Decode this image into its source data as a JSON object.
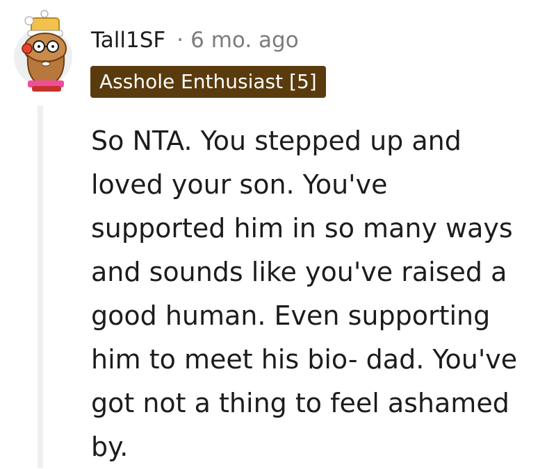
{
  "comment": {
    "author": "Tall1SF",
    "separator": "·",
    "timestamp": "6 mo. ago",
    "flair": "Asshole Enthusiast [5]",
    "avatar_icon": "snoo-avatar-icon",
    "body": "So NTA. You stepped up and\nloved your son. You've\nsupported him in so many ways\nand sounds like you've raised a\ngood human. Even supporting\nhim to meet his bio- dad. You've\ngot not a thing to feel ashamed\nby."
  },
  "colors": {
    "flair_background": "#5a3b0d",
    "flair_text": "#ffffff",
    "thread_line": "#edeff1",
    "meta_text": "#7c7c7c",
    "body_text": "#1c1c1c"
  }
}
